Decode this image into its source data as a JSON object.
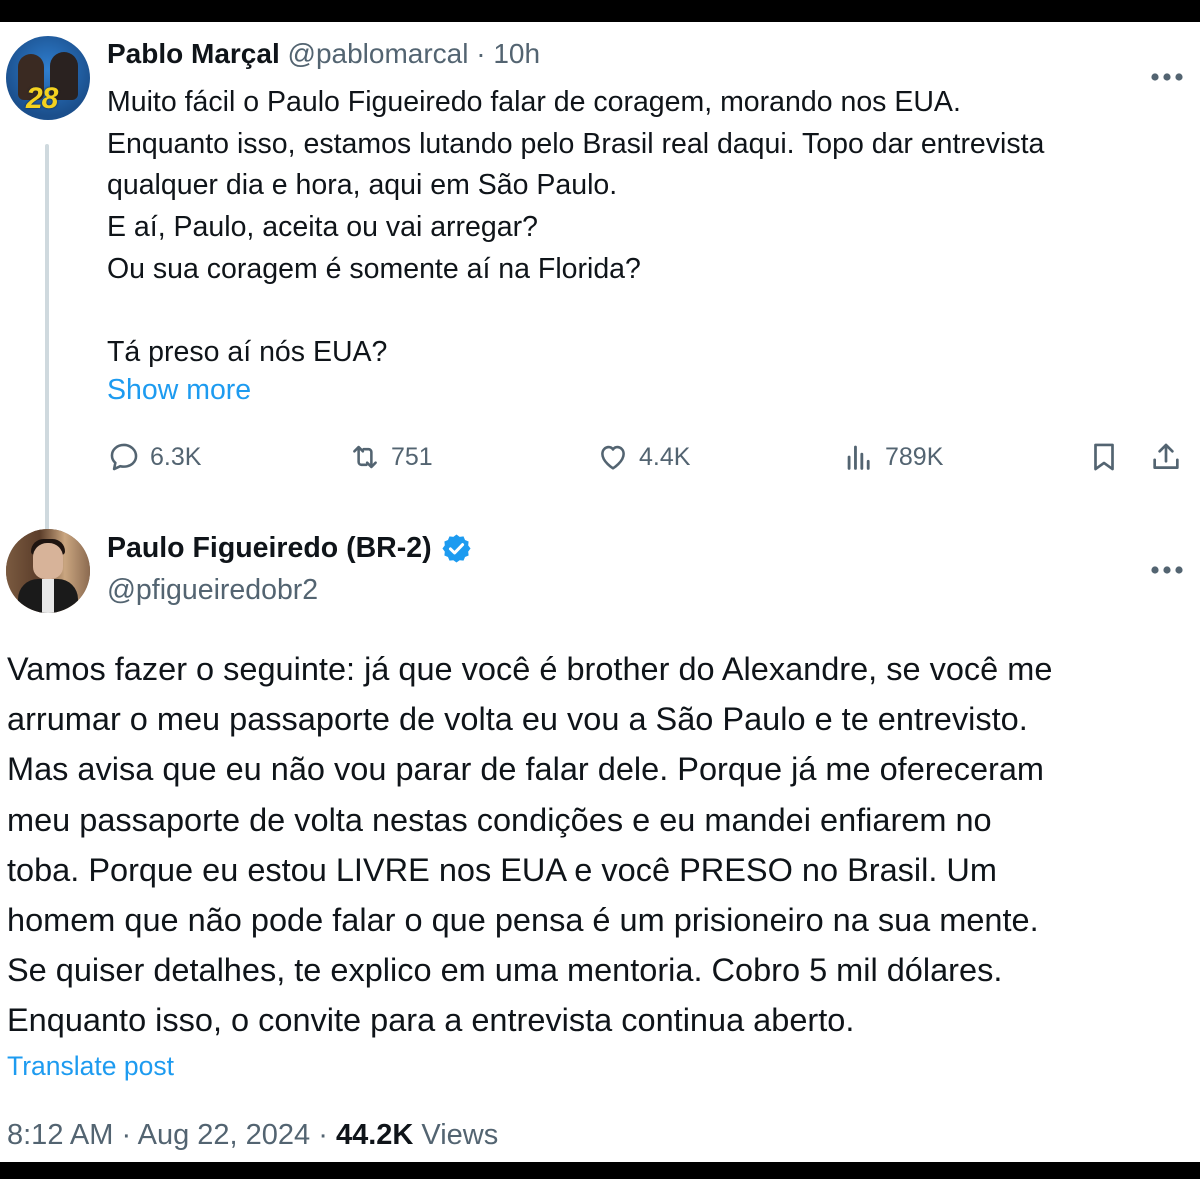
{
  "reply": {
    "name": "Pablo Marçal",
    "handle": "@pablomarcal",
    "separator": "·",
    "time": "10h",
    "avatar_badge": "28",
    "more_icon": "more-horizontal-icon",
    "lines": [
      "Muito fácil o Paulo Figueiredo falar de coragem, morando nos EUA.",
      "Enquanto isso, estamos lutando pelo Brasil real daqui. Topo dar entrevista",
      "qualquer dia e hora, aqui em São Paulo.",
      "E aí, Paulo, aceita ou vai arregar?",
      "Ou sua coragem é somente aí na Florida?",
      "",
      "Tá preso aí nós EUA?"
    ],
    "show_more": "Show more",
    "actions": {
      "replies": "6.3K",
      "reposts": "751",
      "likes": "4.4K",
      "views": "789K"
    }
  },
  "post": {
    "name": "Paulo Figueiredo (BR-2)",
    "handle": "@pfigueiredobr2",
    "verified": true,
    "verified_color": "#1d9bf0",
    "lines": [
      "Vamos fazer o seguinte: já que você é brother do Alexandre, se você me",
      "arrumar o meu passaporte de volta eu vou a São Paulo e te entrevisto.",
      "Mas avisa que eu não vou parar de falar dele. Porque já me ofereceram",
      "meu passaporte de volta nestas condições e eu mandei enfiarem no",
      "toba. Porque eu estou LIVRE nos EUA e você PRESO no Brasil. Um",
      "homem que não pode falar o que pensa é um prisioneiro na sua mente.",
      "Se quiser detalhes, te explico em uma mentoria. Cobro 5 mil dólares.",
      "Enquanto isso, o convite para a entrevista continua aberto."
    ],
    "translate": "Translate post",
    "meta": {
      "time": "8:12 AM",
      "sep1": "·",
      "date": "Aug 22, 2024",
      "sep2": "·",
      "views_count": "44.2K",
      "views_label": "Views"
    }
  },
  "colors": {
    "link": "#1d9bf0",
    "muted": "#536471",
    "text": "#0f1419",
    "thread_line": "#cfd9de"
  }
}
